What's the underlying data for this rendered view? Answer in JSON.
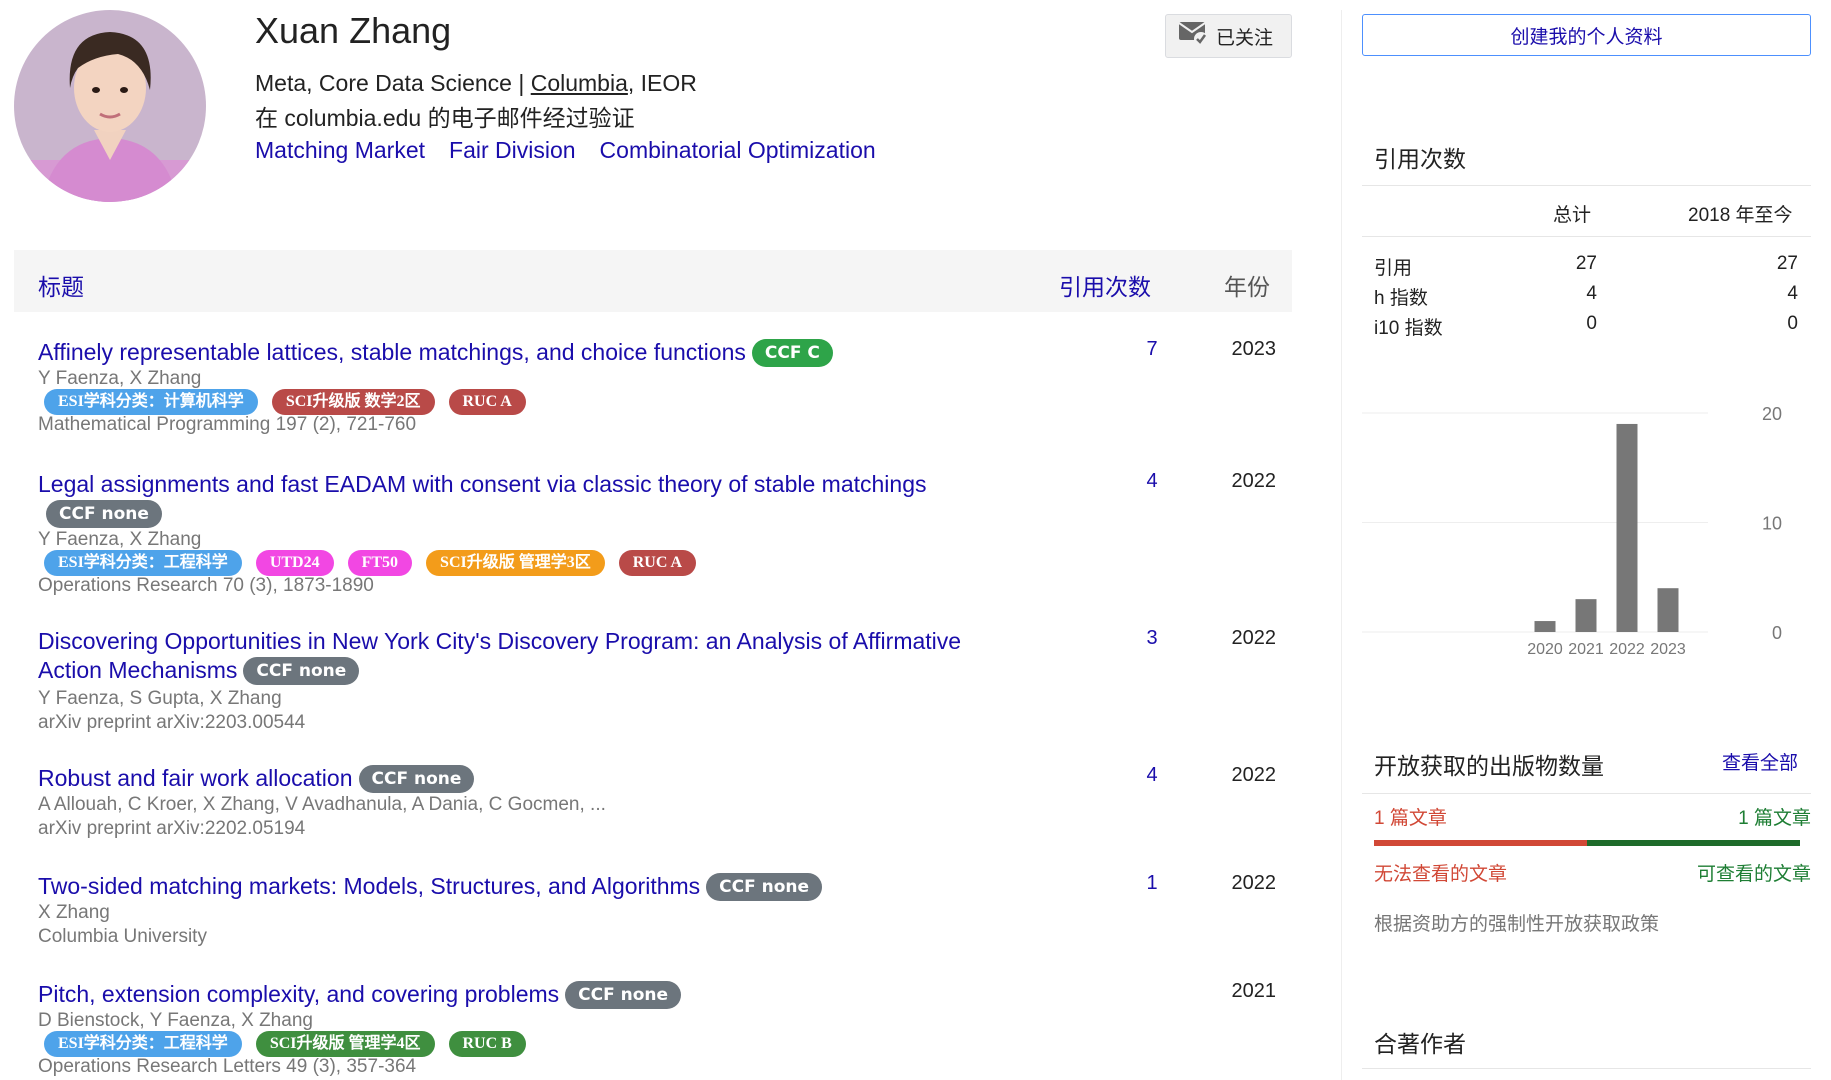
{
  "profile": {
    "name": "Xuan Zhang",
    "affiliation_pre": "Meta, Core Data Science | ",
    "affiliation_link": "Columbia",
    "affiliation_post": ", IEOR",
    "verified": "在 columbia.edu 的电子邮件经过验证",
    "interests": [
      "Matching Market",
      "Fair Division",
      "Combinatorial Optimization"
    ],
    "follow_label": "已关注",
    "follow_icon": "envelope-check-icon"
  },
  "table": {
    "header": {
      "title": "标题",
      "cites": "引用次数",
      "year": "年份"
    },
    "rows": [
      {
        "title": "Affinely representable lattices, stable matchings, and choice functions",
        "ccf": "CCF C",
        "authors": "Y Faenza, X Zhang",
        "tags": [
          "ESI学科分类：计算机科学",
          "SCI升级版 数学2区",
          "RUC A"
        ],
        "venue": "Mathematical Programming 197 (2), 721-760",
        "cites": "7",
        "year": "2023"
      },
      {
        "title": "Legal assignments and fast EADAM with consent via classic theory of stable matchings",
        "ccf": "CCF none",
        "authors": "Y Faenza, X Zhang",
        "tags": [
          "ESI学科分类：工程科学",
          "UTD24",
          "FT50",
          "SCI升级版 管理学3区",
          "RUC A"
        ],
        "venue": "Operations Research 70 (3), 1873-1890",
        "cites": "4",
        "year": "2022"
      },
      {
        "title": "Discovering Opportunities in New York City's Discovery Program: an Analysis of Affirmative Action Mechanisms",
        "ccf": "CCF none",
        "authors": "Y Faenza, S Gupta, X Zhang",
        "tags": [],
        "venue": "arXiv preprint arXiv:2203.00544",
        "cites": "3",
        "year": "2022"
      },
      {
        "title": "Robust and fair work allocation",
        "ccf": "CCF none",
        "authors": "A Allouah, C Kroer, X Zhang, V Avadhanula, A Dania, C Gocmen, ...",
        "tags": [],
        "venue": "arXiv preprint arXiv:2202.05194",
        "cites": "4",
        "year": "2022"
      },
      {
        "title": "Two-sided matching markets: Models, Structures, and Algorithms",
        "ccf": "CCF none",
        "authors": "X Zhang",
        "tags": [],
        "venue": "Columbia University",
        "cites": "1",
        "year": "2022"
      },
      {
        "title": "Pitch, extension complexity, and covering problems",
        "ccf": "CCF none",
        "authors": "D Bienstock, Y Faenza, X Zhang",
        "tags": [
          "ESI学科分类：工程科学",
          "SCI升级版 管理学4区",
          "RUC B"
        ],
        "venue": "Operations Research Letters 49 (3), 357-364",
        "cites": "",
        "year": "2021"
      }
    ]
  },
  "sidebar": {
    "create_label": "创建我的个人资料",
    "cited_title": "引用次数",
    "col_all": "总计",
    "col_since": "2018 年至今",
    "stats": [
      {
        "label": "引用",
        "all": "27",
        "since": "27"
      },
      {
        "label": "h 指数",
        "all": "4",
        "since": "4"
      },
      {
        "label": "i10 指数",
        "all": "0",
        "since": "0"
      }
    ],
    "oa_title": "开放获取的出版物数量",
    "oa_view_all": "查看全部",
    "oa_unavailable_count": "1 篇文章",
    "oa_available_count": "1 篇文章",
    "oa_unavailable_label": "无法查看的文章",
    "oa_available_label": "可查看的文章",
    "oa_policy": "根据资助方的强制性开放获取政策",
    "coauthors_title": "合著作者",
    "oa_split": 0.5
  },
  "chart_data": {
    "type": "bar",
    "categories": [
      "2020",
      "2021",
      "2022",
      "2023"
    ],
    "values": [
      1,
      3,
      19,
      4
    ],
    "yticks": [
      0,
      10,
      20
    ],
    "ylim": [
      0,
      20
    ],
    "color": "#777777"
  },
  "colors": {
    "link": "#1a0dab",
    "ccf_c": "#2ea449",
    "ccf_none": "#6c757d",
    "tag_esi": "#4ea3ea",
    "tag_sci": "#b94a48",
    "tag_utd": "#f247e3",
    "tag_sci_orange": "#f39c1a",
    "tag_ruc_b": "#3f8f3f"
  }
}
